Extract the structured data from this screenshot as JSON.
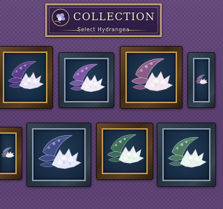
{
  "header": {
    "title": "COLLECTION",
    "subtitle": "Select Hydrangea"
  },
  "colors": {
    "frame_gold": "#c29a55",
    "frame_silver": "#8a9cb1",
    "well_bg": "#1b3047",
    "background": "#5a3f72"
  },
  "cards": [
    {
      "id": "hydrangea-1",
      "frame": "gold",
      "leaf": "#5b3c8a",
      "leaf2": "#c7b0e6",
      "petal": "#e9e2f2"
    },
    {
      "id": "hydrangea-2",
      "frame": "silver",
      "leaf": "#7a56a3",
      "leaf2": "#d6c3ef",
      "petal": "#f1ebf7"
    },
    {
      "id": "hydrangea-3",
      "frame": "gold",
      "leaf": "#8a5c86",
      "leaf2": "#e3c2dc",
      "petal": "#f3e6ee"
    },
    {
      "id": "hydrangea-4",
      "frame": "silver",
      "leaf": "#8a5c86",
      "leaf2": "#e3c2dc",
      "petal": "#f3e6ee"
    },
    {
      "id": "hydrangea-5",
      "frame": "gold",
      "leaf": "#7b6f8e",
      "leaf2": "#d8d0e2",
      "petal": "#f0edf3"
    },
    {
      "id": "hydrangea-6",
      "frame": "silver",
      "leaf": "#404d86",
      "leaf2": "#aab4de",
      "petal": "#e4e7f6"
    },
    {
      "id": "hydrangea-7",
      "frame": "gold",
      "leaf": "#3e6b5a",
      "leaf2": "#bfe0cf",
      "petal": "#e8f2ec"
    },
    {
      "id": "hydrangea-8",
      "frame": "silver",
      "leaf": "#4e7a66",
      "leaf2": "#c4e2d2",
      "petal": "#e9f3ee"
    }
  ]
}
